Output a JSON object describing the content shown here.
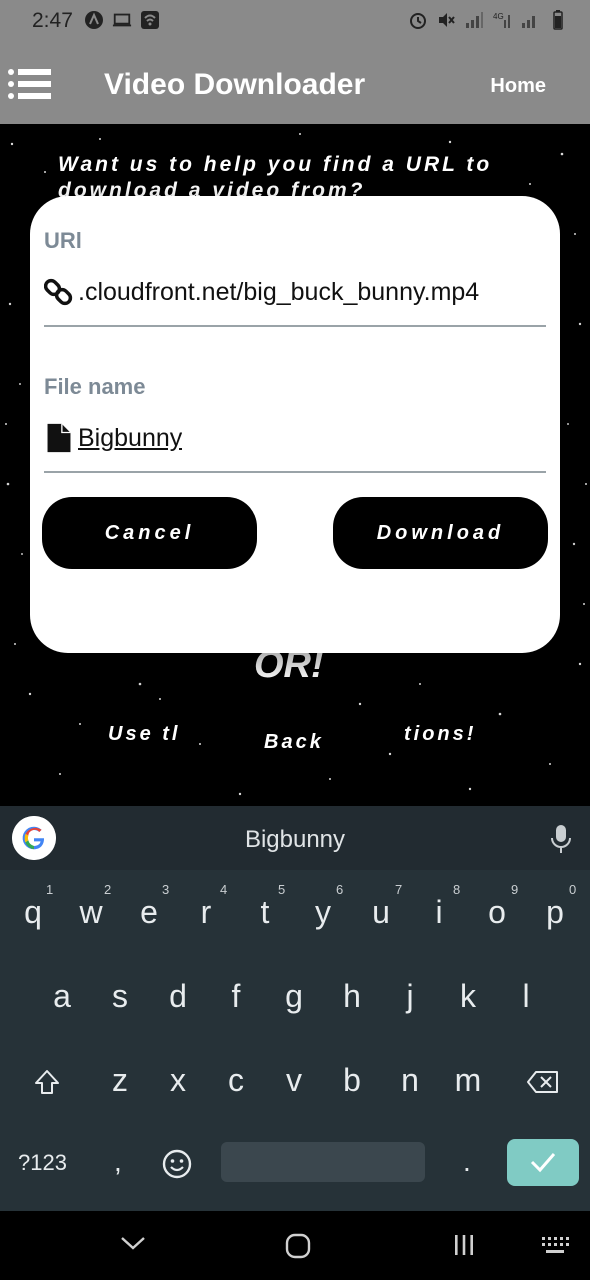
{
  "status_bar": {
    "time": "2:47",
    "left_icons": [
      "android-auto-icon",
      "laptop-icon",
      "wifi-icon"
    ],
    "right_icons": [
      "alarm-icon",
      "mute-icon",
      "signal-icon",
      "4g-signal-icon",
      "signal-icon-2",
      "battery-icon"
    ]
  },
  "app_bar": {
    "title": "Video Downloader",
    "home_label": "Home",
    "menu_icon": "menu-icon"
  },
  "background": {
    "heading": "Want us to help you find a URL to download a video from?",
    "or_text": "OR!",
    "use_text": "Use tl",
    "back_text": "Back",
    "tions_text": "tions!"
  },
  "dialog": {
    "url_label": "URl",
    "url_value": ".cloudfront.net/big_buck_bunny.mp4",
    "url_icon": "link-icon",
    "filename_label": "File name",
    "filename_value": "Bigbunny",
    "filename_icon": "file-icon",
    "cancel_label": "Cancel",
    "download_label": "Download"
  },
  "keyboard": {
    "suggestion": "Bigbunny",
    "row1": [
      "q",
      "w",
      "e",
      "r",
      "t",
      "y",
      "u",
      "i",
      "o",
      "p"
    ],
    "row1_hints": [
      "1",
      "2",
      "3",
      "4",
      "5",
      "6",
      "7",
      "8",
      "9",
      "0"
    ],
    "row2": [
      "a",
      "s",
      "d",
      "f",
      "g",
      "h",
      "j",
      "k",
      "l"
    ],
    "row3": [
      "z",
      "x",
      "c",
      "v",
      "b",
      "n",
      "m"
    ],
    "symbols_key": "?123",
    "comma_key": ",",
    "period_key": ".",
    "accent_color": "#80cbc4"
  },
  "nav_bar": {
    "icons": [
      "back-chevron-icon",
      "home-circle-icon",
      "recents-icon",
      "keyboard-switch-icon"
    ]
  }
}
